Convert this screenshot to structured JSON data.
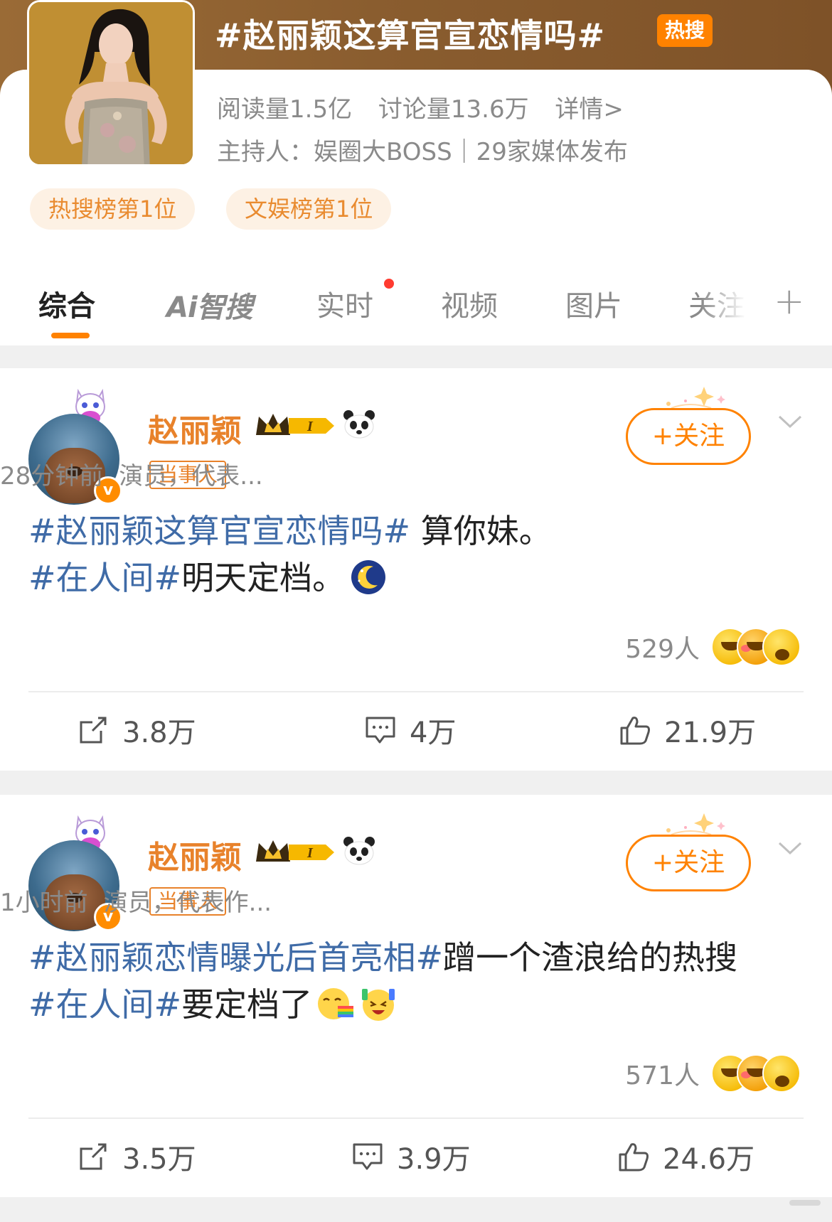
{
  "topic": {
    "title": "#赵丽颖这算官宣恋情吗#",
    "hot_badge": "热搜",
    "read_count": "阅读量1.5亿",
    "discuss_count": "讨论量13.6万",
    "detail_link": "详情>",
    "host": "主持人：娱圈大BOSS｜29家媒体发布",
    "ranks": [
      "热搜榜第1位",
      "文娱榜第1位"
    ]
  },
  "tabs": [
    {
      "label": "综合",
      "active": true
    },
    {
      "label": "Ai智搜"
    },
    {
      "label": "实时",
      "has_dot": true
    },
    {
      "label": "视频"
    },
    {
      "label": "图片"
    },
    {
      "label": "关注"
    }
  ],
  "tabs_more_icon": "plus-icon",
  "posts": [
    {
      "username": "赵丽颖",
      "badge_level": "I",
      "role_tag": "当事人",
      "time": "28分钟前",
      "bio": "演员，代表...",
      "follow_label": "+关注",
      "text_parts": [
        {
          "type": "hashtag",
          "text": "#赵丽颖这算官宣恋情吗#"
        },
        {
          "type": "text",
          "text": " 算你妹。"
        },
        {
          "type": "br"
        },
        {
          "type": "hashtag",
          "text": "#在人间#"
        },
        {
          "type": "text",
          "text": "明天定档。"
        },
        {
          "type": "emoji",
          "name": "moon-emoji"
        }
      ],
      "reaction_count": "529人",
      "shares": "3.8万",
      "comments": "4万",
      "likes": "21.9万"
    },
    {
      "username": "赵丽颖",
      "badge_level": "I",
      "role_tag": "当事人",
      "time": "1小时前",
      "bio": "演员，代表作...",
      "follow_label": "+关注",
      "text_parts": [
        {
          "type": "hashtag",
          "text": "#赵丽颖恋情曝光后首亮相#"
        },
        {
          "type": "text",
          "text": "蹭一个渣浪给的热搜"
        },
        {
          "type": "br"
        },
        {
          "type": "hashtag",
          "text": "#在人间#"
        },
        {
          "type": "text",
          "text": "要定档了"
        },
        {
          "type": "emoji",
          "name": "rainbow-vomit-emoji"
        },
        {
          "type": "emoji",
          "name": "cheer-emoji"
        }
      ],
      "reaction_count": "571人",
      "shares": "3.5万",
      "comments": "3.9万",
      "likes": "24.6万"
    }
  ],
  "colors": {
    "accent_orange": "#ff8200",
    "hashtag_blue": "#3f6ba7",
    "username_orange": "#e8822b",
    "muted_text": "#8a8a8a"
  }
}
